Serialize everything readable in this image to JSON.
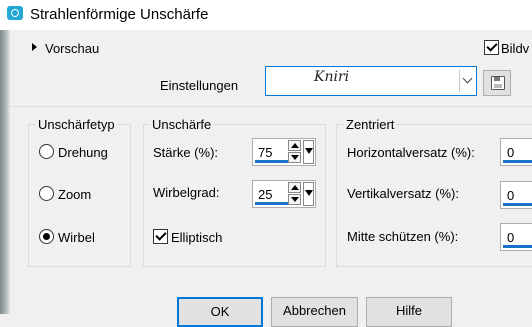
{
  "window": {
    "title": "Strahlenförmige Unschärfe",
    "app_icon": "camera-icon"
  },
  "preview": {
    "label": "Vorschau"
  },
  "image_toggle": {
    "label": "Bildv",
    "checked": true
  },
  "presets": {
    "label": "Einstellungen",
    "value": "Kniri"
  },
  "blur_type": {
    "legend": "Unschärfetyp",
    "options": [
      {
        "label": "Drehung",
        "selected": false
      },
      {
        "label": "Zoom",
        "selected": false
      },
      {
        "label": "Wirbel",
        "selected": true
      }
    ]
  },
  "blur": {
    "legend": "Unschärfe",
    "strength_label": "Stärke (%):",
    "strength_value": "75",
    "twirl_label": "Wirbelgrad:",
    "twirl_value": "25",
    "elliptical_label": "Elliptisch",
    "elliptical_checked": true
  },
  "centered": {
    "legend": "Zentriert",
    "h_offset_label": "Horizontalversatz (%):",
    "h_offset_value": "0",
    "v_offset_label": "Vertikalversatz (%):",
    "v_offset_value": "0",
    "protect_center_label": "Mitte schützen (%):",
    "protect_center_value": "0"
  },
  "buttons": {
    "ok": "OK",
    "cancel": "Abbrechen",
    "help": "Hilfe"
  },
  "colors": {
    "accent": "#0078d7",
    "value_underline": "#1a73c7",
    "app_icon": "#23a8d6"
  }
}
